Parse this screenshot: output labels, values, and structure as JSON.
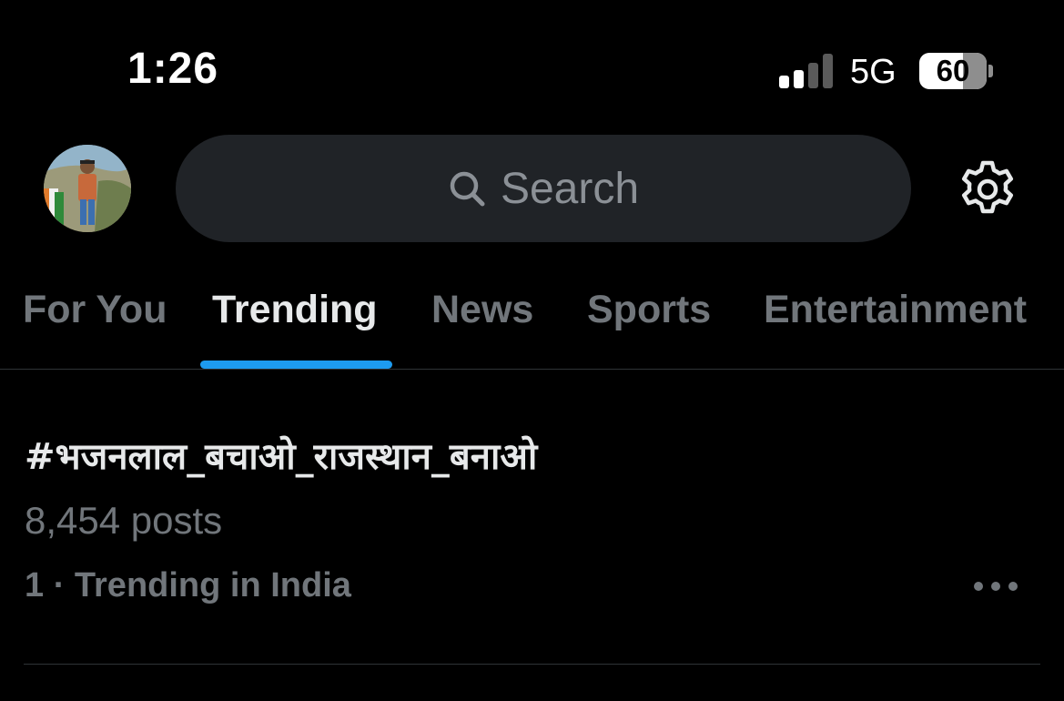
{
  "status_bar": {
    "time": "1:26",
    "network": "5G",
    "battery_percent": "60",
    "battery_level": 0.6,
    "signal_bars_active": 2,
    "signal_bars_total": 4
  },
  "header": {
    "search_placeholder": "Search",
    "icons": {
      "search": "search-icon",
      "settings": "gear-icon",
      "avatar": "profile-avatar"
    }
  },
  "tabs": [
    {
      "label": "For You",
      "active": false
    },
    {
      "label": "Trending",
      "active": true
    },
    {
      "label": "News",
      "active": false
    },
    {
      "label": "Sports",
      "active": false
    },
    {
      "label": "Entertainment",
      "active": false
    }
  ],
  "trends": [
    {
      "name": "#भजनलाल_बचाओ_राजस्थान_बनाओ",
      "count": "8,454 posts",
      "rank_context": "1 · Trending in India"
    }
  ],
  "colors": {
    "background": "#000000",
    "accent": "#1d9bf0",
    "muted_text": "#71767b",
    "primary_text": "#e7e9ea",
    "search_bg": "#202327"
  }
}
